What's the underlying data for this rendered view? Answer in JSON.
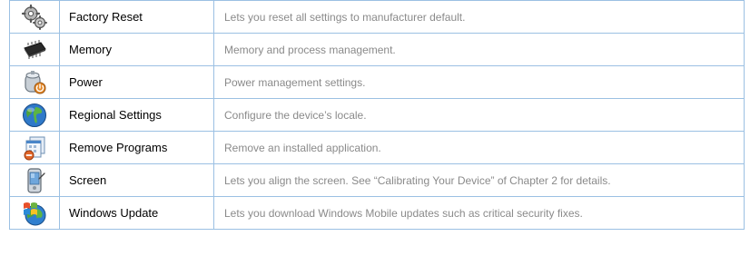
{
  "rows": [
    {
      "icon": "gears-icon",
      "name": "Factory Reset",
      "description": "Lets you reset all settings to manufacturer default."
    },
    {
      "icon": "memory-chip-icon",
      "name": "Memory",
      "description": "Memory and process management."
    },
    {
      "icon": "power-icon",
      "name": "Power",
      "description": "Power management settings."
    },
    {
      "icon": "globe-icon",
      "name": "Regional Settings",
      "description": "Configure the device’s locale."
    },
    {
      "icon": "remove-programs-icon",
      "name": "Remove Programs",
      "description": "Remove an installed application."
    },
    {
      "icon": "handheld-screen-icon",
      "name": "Screen",
      "description": "Lets you align the screen. See “Calibrating Your Device” of Chapter 2 for details."
    },
    {
      "icon": "windows-update-icon",
      "name": "Windows Update",
      "description": "Lets you download Windows Mobile updates such as critical security fixes."
    }
  ]
}
